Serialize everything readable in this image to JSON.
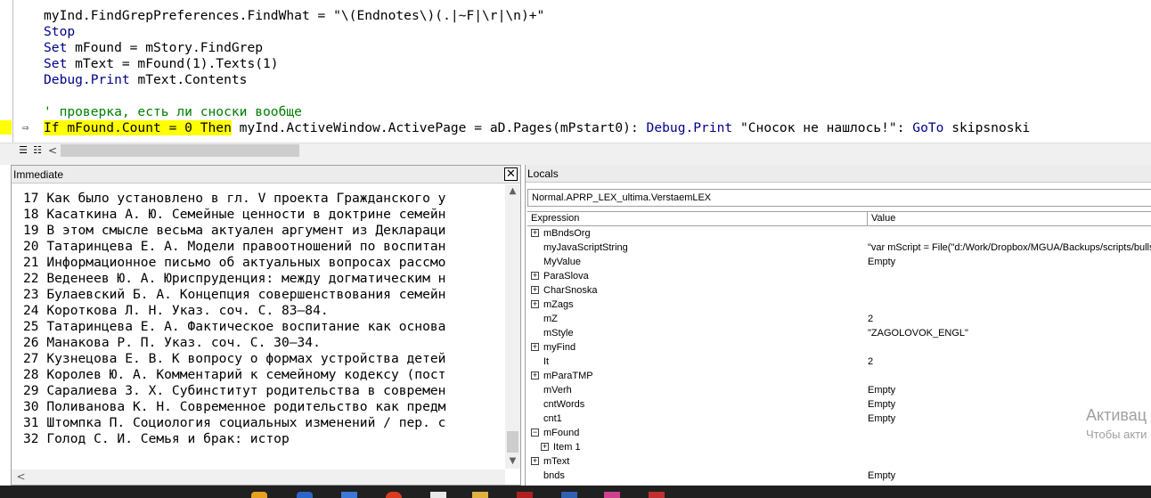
{
  "code": {
    "lines": [
      {
        "segments": [
          {
            "t": "myInd.FindGrepPreferences.FindWhat = \"\\(Endnotes\\)(.|~F|\\r|\\n)+\"",
            "c": "plain"
          }
        ]
      },
      {
        "segments": [
          {
            "t": "Stop",
            "c": "kw"
          }
        ]
      },
      {
        "segments": [
          {
            "t": "Set",
            "c": "kw"
          },
          {
            "t": " mFound = mStory.FindGrep",
            "c": "plain"
          }
        ]
      },
      {
        "segments": [
          {
            "t": "Set",
            "c": "kw"
          },
          {
            "t": " mText = mFound(1).Texts(1)",
            "c": "plain"
          }
        ]
      },
      {
        "segments": [
          {
            "t": "Debug.Print",
            "c": "kw"
          },
          {
            "t": " mText.Contents",
            "c": "plain"
          }
        ]
      },
      {
        "segments": [
          {
            "t": "",
            "c": "plain"
          }
        ]
      },
      {
        "segments": [
          {
            "t": "' проверка, есть ли сноски вообще",
            "c": "cm"
          }
        ]
      },
      {
        "segments": [
          {
            "t": "If mFound.Count = 0 Then",
            "c": "hl"
          },
          {
            "t": " myInd.ActiveWindow.ActivePage = aD.Pages(mPstart0): ",
            "c": "plain"
          },
          {
            "t": "Debug.Print",
            "c": "kw"
          },
          {
            "t": " \"Сносок не нашлось!\": ",
            "c": "plain"
          },
          {
            "t": "GoTo",
            "c": "kw"
          },
          {
            "t": " skipsnoski",
            "c": "plain"
          }
        ]
      }
    ]
  },
  "immediate": {
    "title": "Immediate",
    "close_glyph": "✕",
    "lines": [
      "17 Как было установлено в гл. V проекта Гражданского у",
      "18 Касаткина А. Ю. Семейные ценности в доктрине семейн",
      "19 В этом смысле весьма актуален аргумент из Деклараци",
      "20 Татаринцева Е. А. Модели правоотношений по воспитан",
      "21 Информационное письмо об актуальных вопросах рассмо",
      "22 Веденеев Ю. А. Юриспруденция: между догматическим н",
      "23 Булаевский Б. А. Концепция совершенствования семейн",
      "24 Короткова Л. Н. Указ. соч. С. 83—84.",
      "25 Татаринцева Е. А. Фактическое воспитание как основа",
      "26 Манакова Р. П. Указ. соч. С. 30—34.",
      "27 Кузнецова Е. В. К вопросу о формах устройства детей",
      "28 Королев Ю. А. Комментарий к семейному кодексу (пост",
      "29 Саралиева З. Х. Субинститут родительства в современ",
      "30 Поливанова К. Н. Современное родительство как предм",
      "31 Штомпка П. Социология социальных изменений / пер. с",
      "32 Голод С. И. Семья и брак: истор"
    ]
  },
  "locals": {
    "title": "Locals",
    "context": "Normal.APRP_LEX_ultima.VerstaemLEX",
    "col_expression": "Expression",
    "col_value": "Value",
    "rows": [
      {
        "name": "mBndsOrg",
        "value": "",
        "exp": "+",
        "indent": 0
      },
      {
        "name": "myJavaScriptString",
        "value": "\"var mScript = File(\"d:/Work/Dropbox/MGUA/Backups/scripts/bulls.",
        "exp": "",
        "indent": 0
      },
      {
        "name": "MyValue",
        "value": "Empty",
        "exp": "",
        "indent": 0
      },
      {
        "name": "ParaSlova",
        "value": "",
        "exp": "+",
        "indent": 0
      },
      {
        "name": "CharSnoska",
        "value": "",
        "exp": "+",
        "indent": 0
      },
      {
        "name": "mZags",
        "value": "",
        "exp": "+",
        "indent": 0
      },
      {
        "name": "mZ",
        "value": "2",
        "exp": "",
        "indent": 0
      },
      {
        "name": "mStyle",
        "value": "\"ZAGOLOVOK_ENGL\"",
        "exp": "",
        "indent": 0
      },
      {
        "name": "myFind",
        "value": "",
        "exp": "+",
        "indent": 0
      },
      {
        "name": "It",
        "value": "2",
        "exp": "",
        "indent": 0
      },
      {
        "name": "mParaTMP",
        "value": "",
        "exp": "+",
        "indent": 0
      },
      {
        "name": "mVerh",
        "value": "Empty",
        "exp": "",
        "indent": 0
      },
      {
        "name": "cntWords",
        "value": "Empty",
        "exp": "",
        "indent": 0
      },
      {
        "name": "cnt1",
        "value": "Empty",
        "exp": "",
        "indent": 0
      },
      {
        "name": "mFound",
        "value": "",
        "exp": "−",
        "indent": 0
      },
      {
        "name": "Item 1",
        "value": "",
        "exp": "+",
        "indent": 1
      },
      {
        "name": "mText",
        "value": "",
        "exp": "+",
        "indent": 0
      },
      {
        "name": "bnds",
        "value": "Empty",
        "exp": "",
        "indent": 0
      }
    ]
  },
  "watermark": {
    "line1": "Активац",
    "line2": "Чтобы акти"
  },
  "icons": {
    "exec_arrow": "⇨",
    "hscroll_left": "<",
    "scroll_up": "▲",
    "scroll_down": "▼",
    "view_proc": "☰",
    "view_module": "☷"
  },
  "colors": {
    "keyword": "#00008b",
    "comment": "#008000",
    "highlight": "#ffff00",
    "taskbar": "#202020"
  }
}
